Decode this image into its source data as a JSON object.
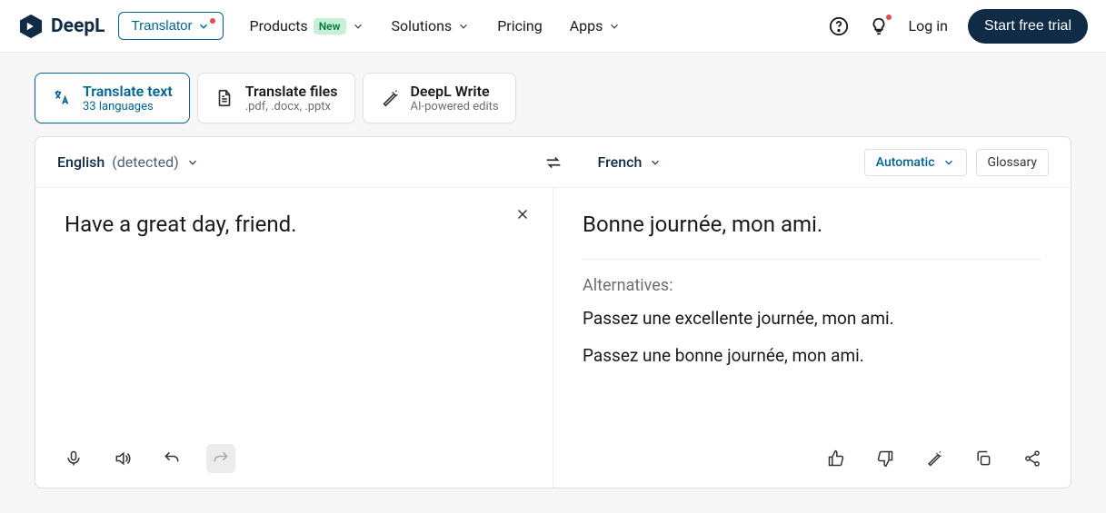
{
  "brand": {
    "name": "DeepL"
  },
  "header": {
    "translator": "Translator",
    "nav": {
      "products": "Products",
      "new_badge": "New",
      "solutions": "Solutions",
      "pricing": "Pricing",
      "apps": "Apps"
    },
    "login": "Log in",
    "trial": "Start free trial"
  },
  "tabs": {
    "translate_text": {
      "title": "Translate text",
      "sub": "33 languages"
    },
    "translate_files": {
      "title": "Translate files",
      "sub": ".pdf, .docx, .pptx"
    },
    "write": {
      "title": "DeepL Write",
      "sub": "AI-powered edits"
    }
  },
  "langbar": {
    "source_lang": "English",
    "detected_suffix": "(detected)",
    "target_lang": "French",
    "automatic": "Automatic",
    "glossary": "Glossary"
  },
  "source": {
    "text": "Have a great day, friend."
  },
  "target": {
    "text": "Bonne journée, mon ami.",
    "alt_label": "Alternatives:",
    "alternatives": [
      "Passez une excellente journée, mon ami.",
      "Passez une bonne journée, mon ami."
    ]
  }
}
